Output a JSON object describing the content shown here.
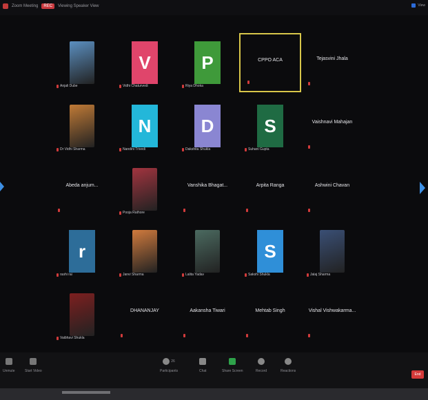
{
  "app": {
    "title": "Zoom Meeting",
    "recording_badge": "REC",
    "meeting_info": "Viewing Speaker View"
  },
  "top_right": {
    "label": "View"
  },
  "grid": {
    "row1": [
      {
        "kind": "photo",
        "name": "Anjali Dube",
        "color": "#5b8fc0"
      },
      {
        "kind": "letter",
        "letter": "V",
        "name": "Vidhi Chaturvedi",
        "color": "#e0456b"
      },
      {
        "kind": "letter",
        "letter": "P",
        "name": "Riya Dhoka",
        "color": "#3f9a3a"
      },
      {
        "kind": "text",
        "name": "CPPO ACA",
        "speaking": true
      },
      {
        "kind": "text",
        "name": "Tejasvini Jhala"
      }
    ],
    "row2": [
      {
        "kind": "photo",
        "name": "Dr Vidhi Sharma",
        "color": "#c07a36"
      },
      {
        "kind": "letter",
        "letter": "N",
        "name": "Nandini Trivedi",
        "color": "#23b7d9"
      },
      {
        "kind": "letter",
        "letter": "D",
        "name": "Dakshita Shukla",
        "color": "#8a86d2"
      },
      {
        "kind": "letter",
        "letter": "S",
        "name": "Suhani Gupta",
        "color": "#1f6b43"
      },
      {
        "kind": "text",
        "name": "Vaishnavi Mahajan"
      }
    ],
    "row3": [
      {
        "kind": "text",
        "name": "Abeda anjum..."
      },
      {
        "kind": "photo",
        "name": "Pooja Rathore",
        "color": "#a2343f"
      },
      {
        "kind": "text",
        "name": "Vanshika Bhagat..."
      },
      {
        "kind": "text",
        "name": "Arpita Ranga"
      },
      {
        "kind": "text",
        "name": "Ashwini Chavan"
      }
    ],
    "row4": [
      {
        "kind": "letter",
        "letter": "r",
        "name": "rashi rai",
        "color": "#2d6d99"
      },
      {
        "kind": "photo",
        "name": "Janvi Sharma",
        "color": "#d07a3d"
      },
      {
        "kind": "photo",
        "name": "Lalita Yadav",
        "color": "#4b6a60"
      },
      {
        "kind": "letter",
        "letter": "S",
        "name": "Sakshi Shukla",
        "color": "#2f8fd8"
      },
      {
        "kind": "photo",
        "name": "Jalaj Sharma",
        "color": "#3a4f75"
      }
    ],
    "row5": [
      {
        "kind": "photo",
        "name": "Vaibhavi Shukla",
        "color": "#7d1f1f"
      },
      {
        "kind": "text",
        "name": "DHANANJAY"
      },
      {
        "kind": "text",
        "name": "Aakansha Tiwari"
      },
      {
        "kind": "text",
        "name": "Mehtab Singh"
      },
      {
        "kind": "text",
        "name": "Vishal Vishwakarma..."
      }
    ]
  },
  "toolbar": {
    "unmute": "Unmute",
    "start_video": "Start Video",
    "participants": "Participants",
    "participants_count": "26",
    "chat": "Chat",
    "share_screen": "Share Screen",
    "record": "Record",
    "reactions": "Reactions",
    "end": "End"
  },
  "colors": {
    "speaker_border": "#d9c74a",
    "accent": "#3d8fe3",
    "end": "#d43a3a"
  }
}
